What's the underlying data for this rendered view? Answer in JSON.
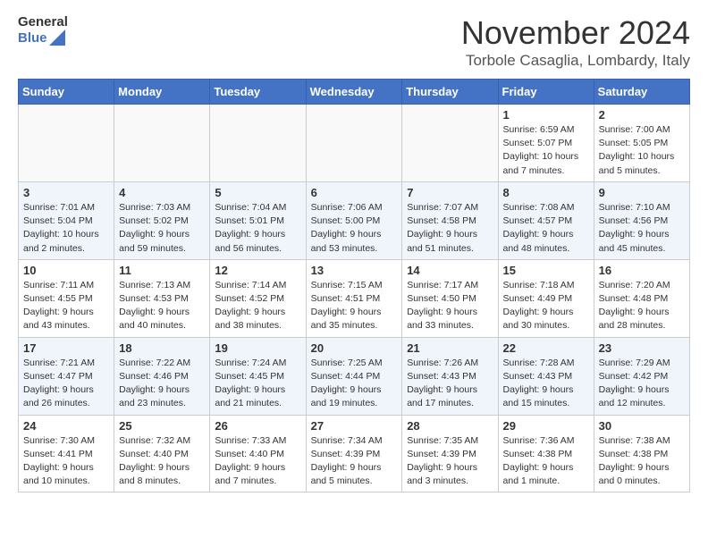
{
  "header": {
    "logo_general": "General",
    "logo_blue": "Blue",
    "month_title": "November 2024",
    "location": "Torbole Casaglia, Lombardy, Italy"
  },
  "weekdays": [
    "Sunday",
    "Monday",
    "Tuesday",
    "Wednesday",
    "Thursday",
    "Friday",
    "Saturday"
  ],
  "weeks": [
    [
      {
        "day": "",
        "info": ""
      },
      {
        "day": "",
        "info": ""
      },
      {
        "day": "",
        "info": ""
      },
      {
        "day": "",
        "info": ""
      },
      {
        "day": "",
        "info": ""
      },
      {
        "day": "1",
        "info": "Sunrise: 6:59 AM\nSunset: 5:07 PM\nDaylight: 10 hours and 7 minutes."
      },
      {
        "day": "2",
        "info": "Sunrise: 7:00 AM\nSunset: 5:05 PM\nDaylight: 10 hours and 5 minutes."
      }
    ],
    [
      {
        "day": "3",
        "info": "Sunrise: 7:01 AM\nSunset: 5:04 PM\nDaylight: 10 hours and 2 minutes."
      },
      {
        "day": "4",
        "info": "Sunrise: 7:03 AM\nSunset: 5:02 PM\nDaylight: 9 hours and 59 minutes."
      },
      {
        "day": "5",
        "info": "Sunrise: 7:04 AM\nSunset: 5:01 PM\nDaylight: 9 hours and 56 minutes."
      },
      {
        "day": "6",
        "info": "Sunrise: 7:06 AM\nSunset: 5:00 PM\nDaylight: 9 hours and 53 minutes."
      },
      {
        "day": "7",
        "info": "Sunrise: 7:07 AM\nSunset: 4:58 PM\nDaylight: 9 hours and 51 minutes."
      },
      {
        "day": "8",
        "info": "Sunrise: 7:08 AM\nSunset: 4:57 PM\nDaylight: 9 hours and 48 minutes."
      },
      {
        "day": "9",
        "info": "Sunrise: 7:10 AM\nSunset: 4:56 PM\nDaylight: 9 hours and 45 minutes."
      }
    ],
    [
      {
        "day": "10",
        "info": "Sunrise: 7:11 AM\nSunset: 4:55 PM\nDaylight: 9 hours and 43 minutes."
      },
      {
        "day": "11",
        "info": "Sunrise: 7:13 AM\nSunset: 4:53 PM\nDaylight: 9 hours and 40 minutes."
      },
      {
        "day": "12",
        "info": "Sunrise: 7:14 AM\nSunset: 4:52 PM\nDaylight: 9 hours and 38 minutes."
      },
      {
        "day": "13",
        "info": "Sunrise: 7:15 AM\nSunset: 4:51 PM\nDaylight: 9 hours and 35 minutes."
      },
      {
        "day": "14",
        "info": "Sunrise: 7:17 AM\nSunset: 4:50 PM\nDaylight: 9 hours and 33 minutes."
      },
      {
        "day": "15",
        "info": "Sunrise: 7:18 AM\nSunset: 4:49 PM\nDaylight: 9 hours and 30 minutes."
      },
      {
        "day": "16",
        "info": "Sunrise: 7:20 AM\nSunset: 4:48 PM\nDaylight: 9 hours and 28 minutes."
      }
    ],
    [
      {
        "day": "17",
        "info": "Sunrise: 7:21 AM\nSunset: 4:47 PM\nDaylight: 9 hours and 26 minutes."
      },
      {
        "day": "18",
        "info": "Sunrise: 7:22 AM\nSunset: 4:46 PM\nDaylight: 9 hours and 23 minutes."
      },
      {
        "day": "19",
        "info": "Sunrise: 7:24 AM\nSunset: 4:45 PM\nDaylight: 9 hours and 21 minutes."
      },
      {
        "day": "20",
        "info": "Sunrise: 7:25 AM\nSunset: 4:44 PM\nDaylight: 9 hours and 19 minutes."
      },
      {
        "day": "21",
        "info": "Sunrise: 7:26 AM\nSunset: 4:43 PM\nDaylight: 9 hours and 17 minutes."
      },
      {
        "day": "22",
        "info": "Sunrise: 7:28 AM\nSunset: 4:43 PM\nDaylight: 9 hours and 15 minutes."
      },
      {
        "day": "23",
        "info": "Sunrise: 7:29 AM\nSunset: 4:42 PM\nDaylight: 9 hours and 12 minutes."
      }
    ],
    [
      {
        "day": "24",
        "info": "Sunrise: 7:30 AM\nSunset: 4:41 PM\nDaylight: 9 hours and 10 minutes."
      },
      {
        "day": "25",
        "info": "Sunrise: 7:32 AM\nSunset: 4:40 PM\nDaylight: 9 hours and 8 minutes."
      },
      {
        "day": "26",
        "info": "Sunrise: 7:33 AM\nSunset: 4:40 PM\nDaylight: 9 hours and 7 minutes."
      },
      {
        "day": "27",
        "info": "Sunrise: 7:34 AM\nSunset: 4:39 PM\nDaylight: 9 hours and 5 minutes."
      },
      {
        "day": "28",
        "info": "Sunrise: 7:35 AM\nSunset: 4:39 PM\nDaylight: 9 hours and 3 minutes."
      },
      {
        "day": "29",
        "info": "Sunrise: 7:36 AM\nSunset: 4:38 PM\nDaylight: 9 hours and 1 minute."
      },
      {
        "day": "30",
        "info": "Sunrise: 7:38 AM\nSunset: 4:38 PM\nDaylight: 9 hours and 0 minutes."
      }
    ]
  ]
}
